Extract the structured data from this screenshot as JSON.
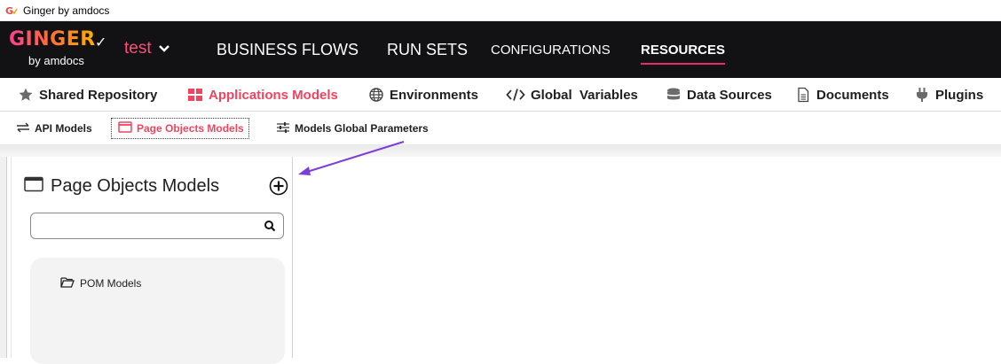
{
  "window": {
    "title": "Ginger by amdocs",
    "app_icon": "ginger-logo-icon"
  },
  "topnav": {
    "logo_text": "GINGER",
    "logo_subtext": "by amdocs",
    "solution_name": "test",
    "tabs": [
      {
        "label": "BUSINESS FLOWS"
      },
      {
        "label": "RUN SETS"
      },
      {
        "label": "CONFIGURATIONS"
      },
      {
        "label": "RESOURCES",
        "active": true
      }
    ],
    "accent_color": "#e8296b"
  },
  "submenu": {
    "items": [
      {
        "label": "Shared Repository",
        "icon": "star-icon"
      },
      {
        "label": "Applications Models",
        "icon": "grid-icon",
        "active": true
      },
      {
        "label": "Environments",
        "icon": "globe-icon"
      },
      {
        "label": "Global  Variables",
        "icon": "code-icon"
      },
      {
        "label": "Data Sources",
        "icon": "database-icon"
      },
      {
        "label": "Documents",
        "icon": "document-icon"
      },
      {
        "label": "Plugins",
        "icon": "plug-icon"
      }
    ],
    "active_color": "#f0445f"
  },
  "subsub": {
    "items": [
      {
        "label": "API Models",
        "icon": "exchange-icon"
      },
      {
        "label": "Page Objects Models",
        "icon": "window-icon",
        "active": true
      },
      {
        "label": "Models Global Parameters",
        "icon": "sliders-icon"
      }
    ]
  },
  "panel": {
    "title": "Page Objects Models",
    "search": {
      "value": "",
      "placeholder": ""
    },
    "tree": [
      {
        "label": "POM Models",
        "icon": "folder-open-icon"
      }
    ]
  },
  "annotation": {
    "arrow_color": "#7b3fd6"
  }
}
